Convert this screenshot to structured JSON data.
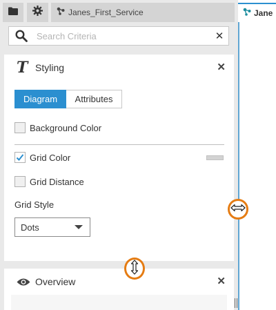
{
  "top_tabs": {
    "folder_icon": "folder-icon",
    "settings_icon": "gear-icon",
    "service_tab_label": "Janes_First_Service",
    "service_tab_icon": "service-graph-icon"
  },
  "search": {
    "placeholder": "Search Criteria",
    "value": ""
  },
  "styling_panel": {
    "title": "Styling",
    "title_icon": "T",
    "tabs": [
      {
        "label": "Diagram",
        "active": true
      },
      {
        "label": "Attributes",
        "active": false
      }
    ],
    "options": [
      {
        "label": "Background Color",
        "checked": false
      },
      {
        "label": "Grid Color",
        "checked": true
      },
      {
        "label": "Grid Distance",
        "checked": false
      }
    ],
    "grid_style_label": "Grid Style",
    "grid_style_value": "Dots"
  },
  "overview_panel": {
    "title": "Overview"
  },
  "editor_tab": {
    "label": "Jane"
  },
  "colors": {
    "accent": "#2b8fd0",
    "highlight": "#e57c13",
    "grid_color_swatch": "#d3d3d3"
  }
}
